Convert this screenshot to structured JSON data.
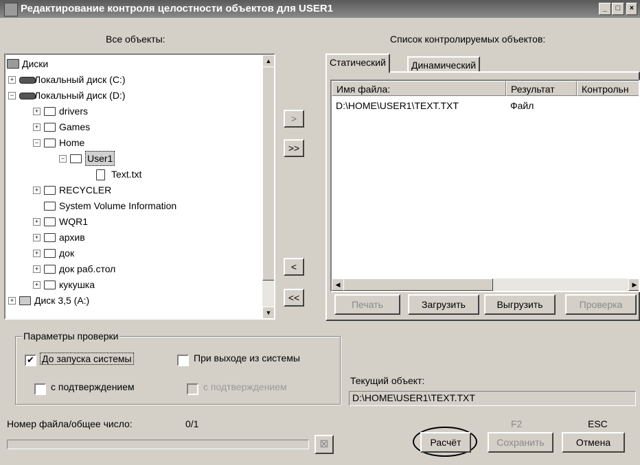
{
  "window": {
    "title": "Редактирование контроля целостности объектов для USER1",
    "minimize": "_",
    "maximize": "□",
    "close": "×"
  },
  "left_panel": {
    "header": "Все объекты:",
    "tree": [
      {
        "label": "Диски",
        "icon": "computer-icon"
      },
      {
        "label": "Локальный диск (C:)",
        "icon": "disk-icon"
      },
      {
        "label": "Локальный диск (D:)",
        "icon": "disk-icon"
      },
      {
        "label": "drivers",
        "icon": "folder-icon"
      },
      {
        "label": "Games",
        "icon": "folder-icon"
      },
      {
        "label": "Home",
        "icon": "folder-icon"
      },
      {
        "label": "User1",
        "icon": "folder-open-icon",
        "selected": true
      },
      {
        "label": "Text.txt",
        "icon": "text-file-icon"
      },
      {
        "label": "RECYCLER",
        "icon": "folder-icon"
      },
      {
        "label": "System Volume Information",
        "icon": "folder-icon"
      },
      {
        "label": "WQR1",
        "icon": "folder-icon"
      },
      {
        "label": "архив",
        "icon": "folder-icon"
      },
      {
        "label": "док",
        "icon": "folder-icon"
      },
      {
        "label": "док раб.стол",
        "icon": "folder-icon"
      },
      {
        "label": "кукушка",
        "icon": "folder-icon"
      },
      {
        "label": "Диск 3,5 (A:)",
        "icon": "floppy-icon"
      }
    ]
  },
  "transfer_buttons": {
    "add": ">",
    "add_all": ">>",
    "remove": "<",
    "remove_all": "<<"
  },
  "right_panel": {
    "header": "Список контролируемых объектов:",
    "tabs": [
      "Статический",
      "Динамический"
    ],
    "columns": [
      "Имя файла:",
      "Результат",
      "Контрольн"
    ],
    "rows": [
      {
        "file": "D:\\HOME\\USER1\\TEXT.TXT",
        "result": "Файл",
        "control": ""
      }
    ],
    "buttons": {
      "print": "Печать",
      "load": "Загрузить",
      "unload": "Выгрузить",
      "check": "Проверка"
    }
  },
  "check_params": {
    "legend": "Параметры проверки",
    "before_start": {
      "label": "До запуска системы",
      "checked": true
    },
    "on_exit": {
      "label": "При выходе из системы",
      "checked": false
    },
    "confirm1": {
      "label": "с подтверждением",
      "checked": false
    },
    "confirm2": {
      "label": "с подтверждением",
      "checked": false,
      "disabled": true
    }
  },
  "current_object": {
    "label": "Текущий объект:",
    "value": "D:\\HOME\\USER1\\TEXT.TXT"
  },
  "progress": {
    "label": "Номер файла/общее число:",
    "value": "0/1",
    "fraction": 0
  },
  "footer": {
    "f2_hint": "F2",
    "esc_hint": "ESC",
    "calc": "Расчёт",
    "save": "Сохранить",
    "cancel": "Отмена"
  }
}
